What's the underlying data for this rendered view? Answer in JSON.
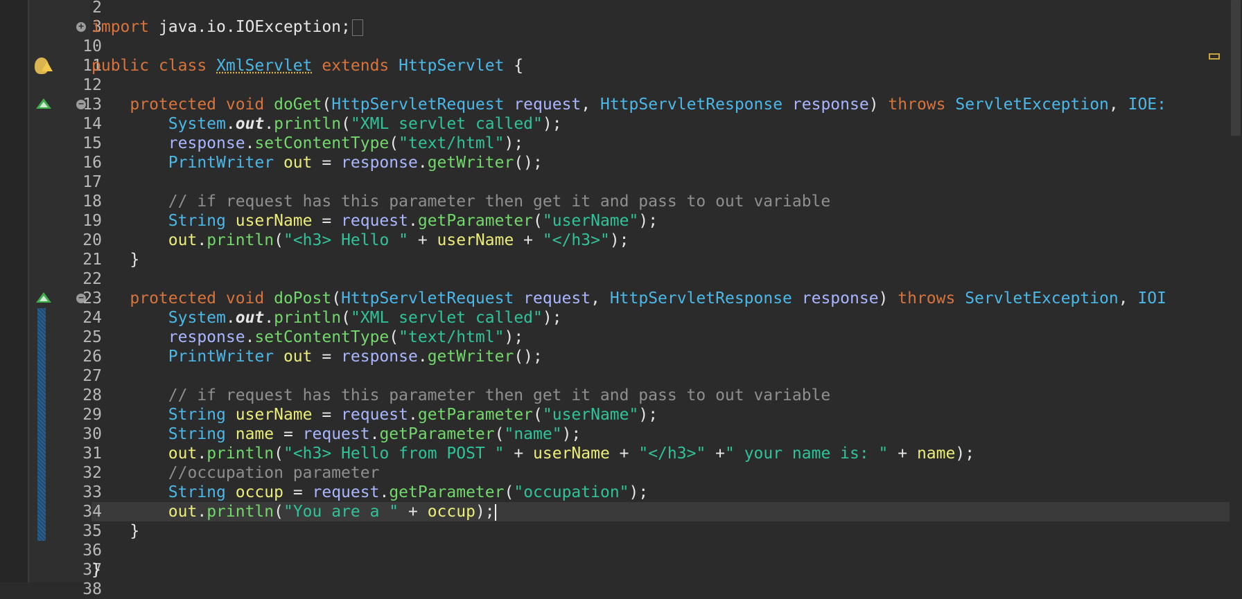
{
  "editor": {
    "lines": [
      {
        "num": "2",
        "tokens": []
      },
      {
        "num": "3",
        "gutter": "fold-plus",
        "tokens": [
          {
            "c": "k",
            "t": "import "
          },
          {
            "c": "w",
            "t": "java.io.IOException;"
          }
        ],
        "collapsed": true
      },
      {
        "num": "10",
        "tokens": []
      },
      {
        "num": "11",
        "gutter": "bulb-warning",
        "tokens": [
          {
            "c": "k",
            "t": "public class "
          },
          {
            "c": "t ul",
            "t": "XmlServlet"
          },
          {
            "c": "k",
            "t": " extends "
          },
          {
            "c": "t",
            "t": "HttpServlet"
          },
          {
            "c": "w",
            "t": " {"
          }
        ]
      },
      {
        "num": "12",
        "tokens": []
      },
      {
        "num": "13",
        "gutter": "override-fold",
        "tokens": [
          {
            "c": "k",
            "t": "    protected void "
          },
          {
            "c": "f",
            "t": "doGet"
          },
          {
            "c": "w",
            "t": "("
          },
          {
            "c": "t",
            "t": "HttpServletRequest "
          },
          {
            "c": "v",
            "t": "request"
          },
          {
            "c": "w",
            "t": ", "
          },
          {
            "c": "t",
            "t": "HttpServletResponse "
          },
          {
            "c": "v",
            "t": "response"
          },
          {
            "c": "w",
            "t": ") "
          },
          {
            "c": "k",
            "t": "throws "
          },
          {
            "c": "t",
            "t": "ServletException"
          },
          {
            "c": "w",
            "t": ", "
          },
          {
            "c": "t",
            "t": "IOE:"
          }
        ]
      },
      {
        "num": "14",
        "tokens": [
          {
            "c": "t",
            "t": "        System"
          },
          {
            "c": "w",
            "t": "."
          },
          {
            "c": "st",
            "t": "out"
          },
          {
            "c": "w",
            "t": "."
          },
          {
            "c": "f",
            "t": "println"
          },
          {
            "c": "w",
            "t": "("
          },
          {
            "c": "s",
            "t": "\"XML servlet called\""
          },
          {
            "c": "w",
            "t": ");"
          }
        ]
      },
      {
        "num": "15",
        "tokens": [
          {
            "c": "v",
            "t": "        response"
          },
          {
            "c": "w",
            "t": "."
          },
          {
            "c": "f",
            "t": "setContentType"
          },
          {
            "c": "w",
            "t": "("
          },
          {
            "c": "s",
            "t": "\"text/html\""
          },
          {
            "c": "w",
            "t": ");"
          }
        ]
      },
      {
        "num": "16",
        "tokens": [
          {
            "c": "t",
            "t": "        PrintWriter "
          },
          {
            "c": "y",
            "t": "out"
          },
          {
            "c": "w",
            "t": " = "
          },
          {
            "c": "v",
            "t": "response"
          },
          {
            "c": "w",
            "t": "."
          },
          {
            "c": "f",
            "t": "getWriter"
          },
          {
            "c": "w",
            "t": "();"
          }
        ]
      },
      {
        "num": "17",
        "tokens": []
      },
      {
        "num": "18",
        "tokens": [
          {
            "c": "c",
            "t": "        // if request has this parameter then get it and pass to out variable"
          }
        ]
      },
      {
        "num": "19",
        "tokens": [
          {
            "c": "t",
            "t": "        String "
          },
          {
            "c": "y",
            "t": "userName"
          },
          {
            "c": "w",
            "t": " = "
          },
          {
            "c": "v",
            "t": "request"
          },
          {
            "c": "w",
            "t": "."
          },
          {
            "c": "f",
            "t": "getParameter"
          },
          {
            "c": "w",
            "t": "("
          },
          {
            "c": "s",
            "t": "\"userName\""
          },
          {
            "c": "w",
            "t": ");"
          }
        ]
      },
      {
        "num": "20",
        "tokens": [
          {
            "c": "y",
            "t": "        out"
          },
          {
            "c": "w",
            "t": "."
          },
          {
            "c": "f",
            "t": "println"
          },
          {
            "c": "w",
            "t": "("
          },
          {
            "c": "s",
            "t": "\"<h3> Hello \""
          },
          {
            "c": "w",
            "t": " + "
          },
          {
            "c": "y",
            "t": "userName"
          },
          {
            "c": "w",
            "t": " + "
          },
          {
            "c": "s",
            "t": "\"</h3>\""
          },
          {
            "c": "w",
            "t": ");"
          }
        ]
      },
      {
        "num": "21",
        "tokens": [
          {
            "c": "w",
            "t": "    }"
          }
        ]
      },
      {
        "num": "22",
        "tokens": []
      },
      {
        "num": "23",
        "gutter": "override-fold",
        "tokens": [
          {
            "c": "k",
            "t": "    protected void "
          },
          {
            "c": "f",
            "t": "doPost"
          },
          {
            "c": "w",
            "t": "("
          },
          {
            "c": "t",
            "t": "HttpServletRequest "
          },
          {
            "c": "v",
            "t": "request"
          },
          {
            "c": "w",
            "t": ", "
          },
          {
            "c": "t",
            "t": "HttpServletResponse "
          },
          {
            "c": "v",
            "t": "response"
          },
          {
            "c": "w",
            "t": ") "
          },
          {
            "c": "k",
            "t": "throws "
          },
          {
            "c": "t",
            "t": "ServletException"
          },
          {
            "c": "w",
            "t": ", "
          },
          {
            "c": "t",
            "t": "IOI"
          }
        ]
      },
      {
        "num": "24",
        "change": true,
        "tokens": [
          {
            "c": "t",
            "t": "        System"
          },
          {
            "c": "w",
            "t": "."
          },
          {
            "c": "st",
            "t": "out"
          },
          {
            "c": "w",
            "t": "."
          },
          {
            "c": "f",
            "t": "println"
          },
          {
            "c": "w",
            "t": "("
          },
          {
            "c": "s",
            "t": "\"XML servlet called\""
          },
          {
            "c": "w",
            "t": ");"
          }
        ]
      },
      {
        "num": "25",
        "change": true,
        "tokens": [
          {
            "c": "v",
            "t": "        response"
          },
          {
            "c": "w",
            "t": "."
          },
          {
            "c": "f",
            "t": "setContentType"
          },
          {
            "c": "w",
            "t": "("
          },
          {
            "c": "s",
            "t": "\"text/html\""
          },
          {
            "c": "w",
            "t": ");"
          }
        ]
      },
      {
        "num": "26",
        "change": true,
        "tokens": [
          {
            "c": "t",
            "t": "        PrintWriter "
          },
          {
            "c": "y",
            "t": "out"
          },
          {
            "c": "w",
            "t": " = "
          },
          {
            "c": "v",
            "t": "response"
          },
          {
            "c": "w",
            "t": "."
          },
          {
            "c": "f",
            "t": "getWriter"
          },
          {
            "c": "w",
            "t": "();"
          }
        ]
      },
      {
        "num": "27",
        "change": true,
        "tokens": []
      },
      {
        "num": "28",
        "change": true,
        "tokens": [
          {
            "c": "c",
            "t": "        // if request has this parameter then get it and pass to out variable"
          }
        ]
      },
      {
        "num": "29",
        "change": true,
        "tokens": [
          {
            "c": "t",
            "t": "        String "
          },
          {
            "c": "y",
            "t": "userName"
          },
          {
            "c": "w",
            "t": " = "
          },
          {
            "c": "v",
            "t": "request"
          },
          {
            "c": "w",
            "t": "."
          },
          {
            "c": "f",
            "t": "getParameter"
          },
          {
            "c": "w",
            "t": "("
          },
          {
            "c": "s",
            "t": "\"userName\""
          },
          {
            "c": "w",
            "t": ");"
          }
        ]
      },
      {
        "num": "30",
        "change": true,
        "tokens": [
          {
            "c": "t",
            "t": "        String "
          },
          {
            "c": "y",
            "t": "name"
          },
          {
            "c": "w",
            "t": " = "
          },
          {
            "c": "v",
            "t": "request"
          },
          {
            "c": "w",
            "t": "."
          },
          {
            "c": "f",
            "t": "getParameter"
          },
          {
            "c": "w",
            "t": "("
          },
          {
            "c": "s",
            "t": "\"name\""
          },
          {
            "c": "w",
            "t": ");"
          }
        ]
      },
      {
        "num": "31",
        "change": true,
        "tokens": [
          {
            "c": "y",
            "t": "        out"
          },
          {
            "c": "w",
            "t": "."
          },
          {
            "c": "f",
            "t": "println"
          },
          {
            "c": "w",
            "t": "("
          },
          {
            "c": "s",
            "t": "\"<h3> Hello from POST \""
          },
          {
            "c": "w",
            "t": " + "
          },
          {
            "c": "y",
            "t": "userName"
          },
          {
            "c": "w",
            "t": " + "
          },
          {
            "c": "s",
            "t": "\"</h3>\""
          },
          {
            "c": "w",
            "t": " +"
          },
          {
            "c": "s",
            "t": "\" your name is: \""
          },
          {
            "c": "w",
            "t": " + "
          },
          {
            "c": "y",
            "t": "name"
          },
          {
            "c": "w",
            "t": ");"
          }
        ]
      },
      {
        "num": "32",
        "change": true,
        "tokens": [
          {
            "c": "c",
            "t": "        //occupation parameter"
          }
        ]
      },
      {
        "num": "33",
        "change": true,
        "tokens": [
          {
            "c": "t",
            "t": "        String "
          },
          {
            "c": "y",
            "t": "occup"
          },
          {
            "c": "w",
            "t": " = "
          },
          {
            "c": "v",
            "t": "request"
          },
          {
            "c": "w",
            "t": "."
          },
          {
            "c": "f",
            "t": "getParameter"
          },
          {
            "c": "w",
            "t": "("
          },
          {
            "c": "s",
            "t": "\"occupation\""
          },
          {
            "c": "w",
            "t": ");"
          }
        ]
      },
      {
        "num": "34",
        "change": true,
        "current": true,
        "caret": true,
        "tokens": [
          {
            "c": "y",
            "t": "        out"
          },
          {
            "c": "w",
            "t": "."
          },
          {
            "c": "f",
            "t": "println"
          },
          {
            "c": "w",
            "t": "("
          },
          {
            "c": "s",
            "t": "\"You are a \""
          },
          {
            "c": "w",
            "t": " + "
          },
          {
            "c": "y",
            "t": "occup"
          },
          {
            "c": "w",
            "t": ");"
          }
        ]
      },
      {
        "num": "35",
        "change": true,
        "tokens": [
          {
            "c": "w",
            "t": "    }"
          }
        ]
      },
      {
        "num": "36",
        "tokens": []
      },
      {
        "num": "37",
        "tokens": [
          {
            "c": "w",
            "t": "}"
          }
        ]
      },
      {
        "num": "38",
        "tokens": []
      }
    ]
  }
}
